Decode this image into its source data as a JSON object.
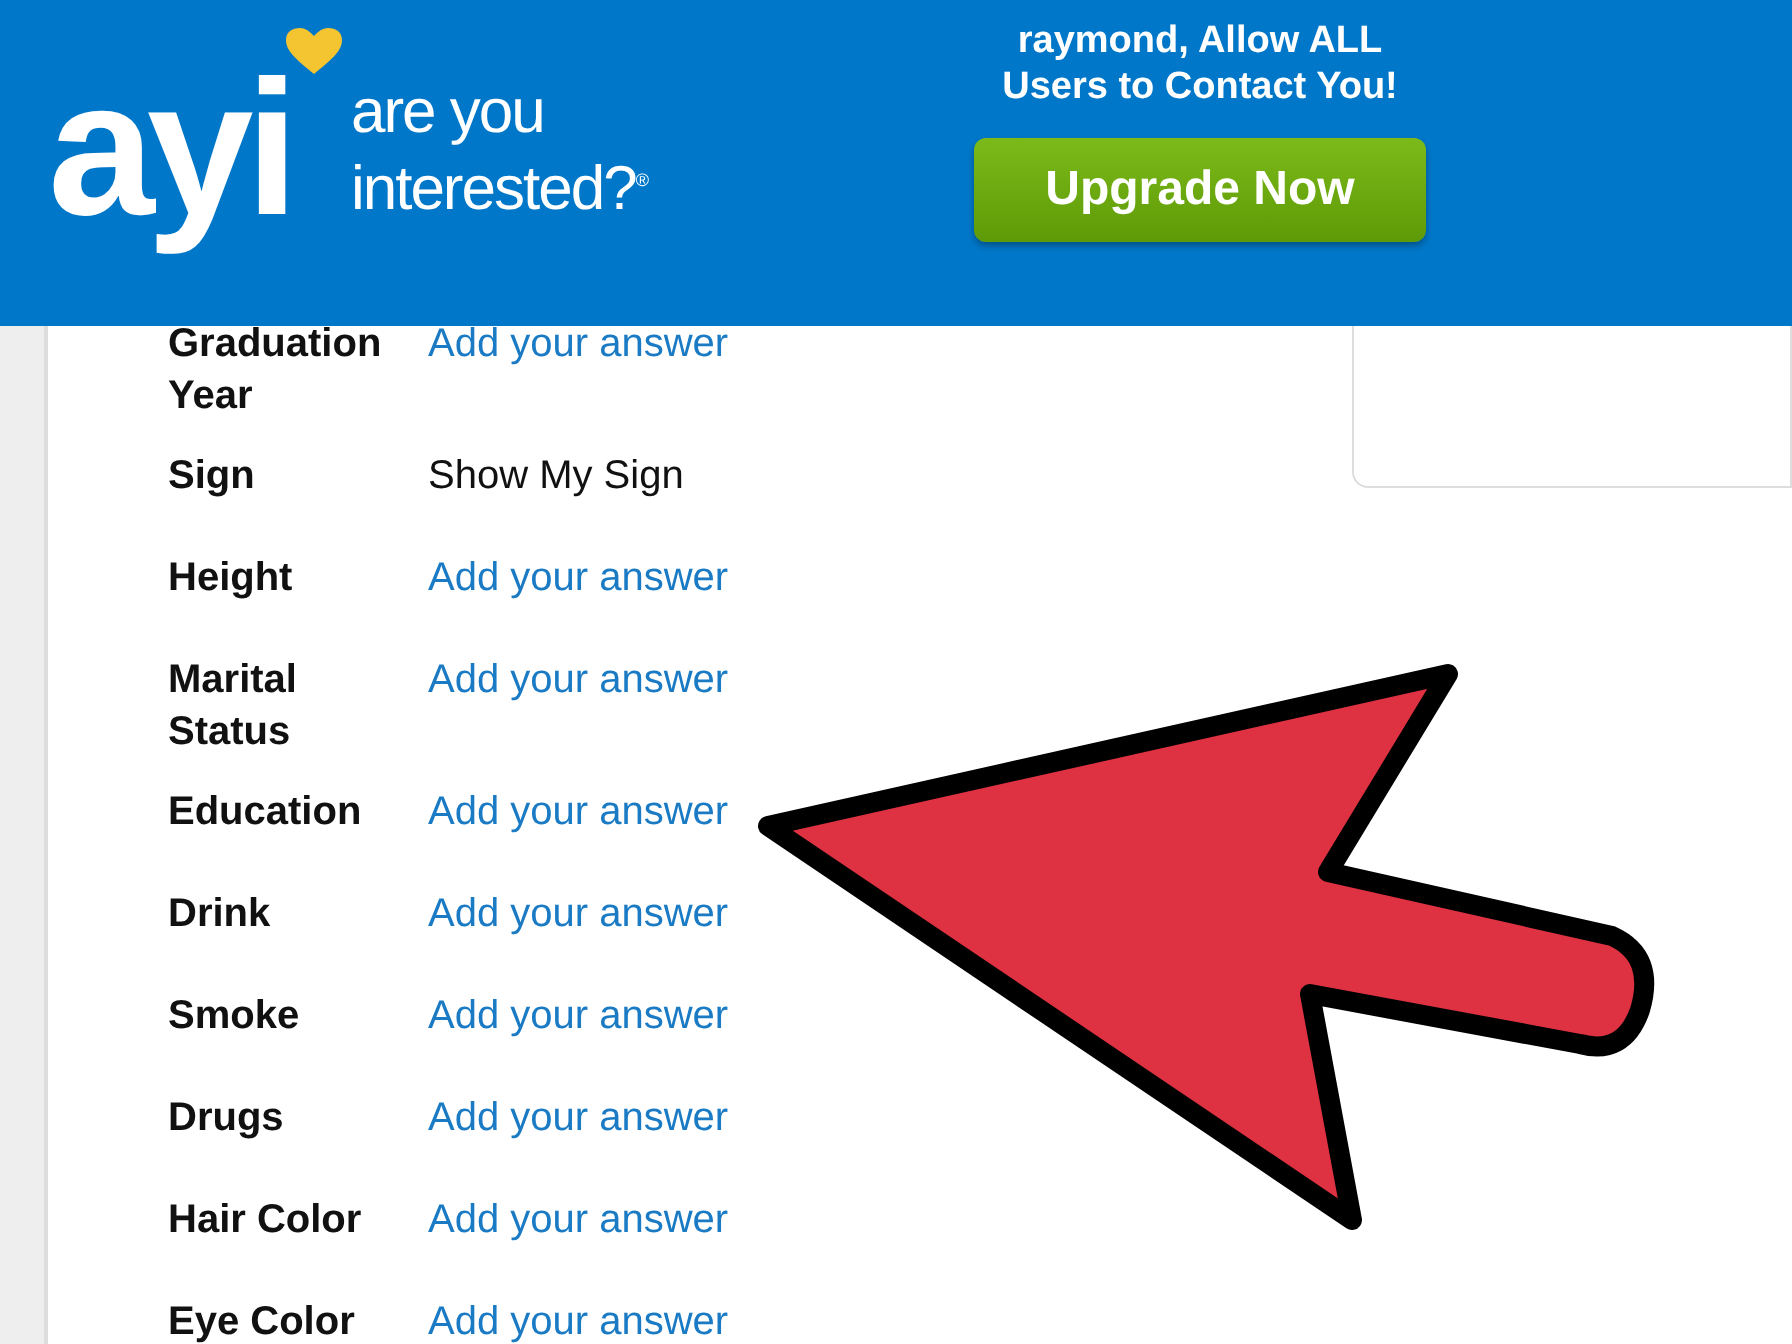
{
  "header": {
    "logo": "ayi",
    "tagline": "are you interested?$^{®}$",
    "promo": "raymond, Allow ALL Users to Contact You!",
    "upgrade_button": "Upgrade Now"
  },
  "profile_fields": [
    {
      "label": "Graduation Year",
      "value": "Add your answer",
      "kind": "link"
    },
    {
      "label": "Sign",
      "value": "Show My Sign",
      "kind": "text"
    },
    {
      "label": "Height",
      "value": "Add your answer",
      "kind": "link"
    },
    {
      "label": "Marital Status",
      "value": "Add your answer",
      "kind": "link"
    },
    {
      "label": "Education",
      "value": "Add your answer",
      "kind": "link"
    },
    {
      "label": "Drink",
      "value": "Add your answer",
      "kind": "link"
    },
    {
      "label": "Smoke",
      "value": "Add your answer",
      "kind": "link"
    },
    {
      "label": "Drugs",
      "value": "Add your answer",
      "kind": "link"
    },
    {
      "label": "Hair Color",
      "value": "Add your answer",
      "kind": "link"
    },
    {
      "label": "Eye Color",
      "value": "Add your answer",
      "kind": "link"
    }
  ]
}
